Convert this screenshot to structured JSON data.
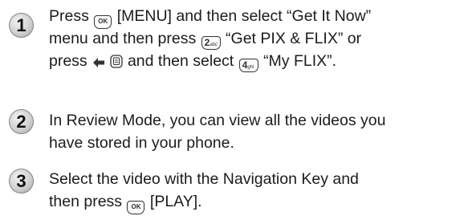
{
  "steps": [
    {
      "number": "1",
      "lines": [
        {
          "t1": "Press",
          "key1": "OK",
          "t2": "[MENU] and then select “Get It Now”"
        },
        {
          "t1": "menu and then press",
          "key1": "2abc",
          "t2": "“Get PIX & FLIX” or"
        },
        {
          "t1": "press",
          "t2": "and then select",
          "key1": "4ghi",
          "t3": "“My FLIX”."
        }
      ]
    },
    {
      "number": "2",
      "lines": [
        {
          "text": "In Review Mode, you can view all the videos you"
        },
        {
          "text": "have stored in your phone."
        }
      ]
    },
    {
      "number": "3",
      "lines": [
        {
          "text": "Select the video with the Navigation Key and"
        },
        {
          "t1": "then press",
          "key1": "OK",
          "t2": "[PLAY]."
        }
      ]
    }
  ],
  "icons": {
    "ok_key": "ok-key-icon",
    "key_2": "key-2abc-icon",
    "nav_left": "navigation-left-icon",
    "get_it_now_key": "get-it-now-key-icon",
    "key_4": "key-4ghi-icon"
  }
}
